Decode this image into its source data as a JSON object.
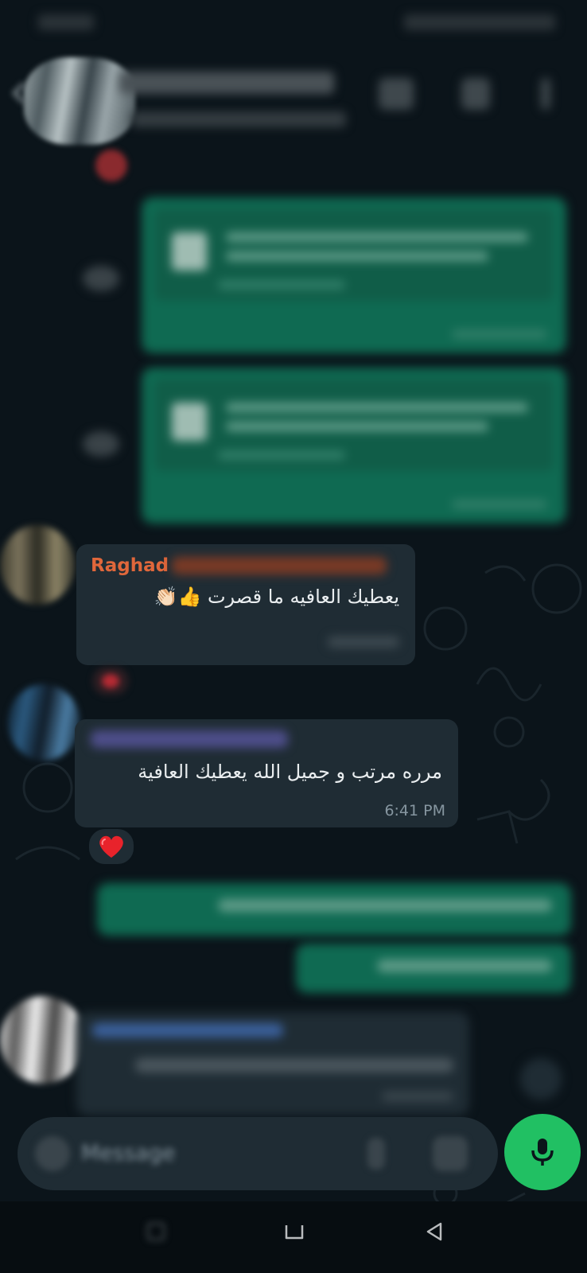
{
  "status_bar": {},
  "header": {},
  "messages": {
    "incoming_1": {
      "sender": "Raghad",
      "text": "يعطيك العافيه ما قصرت 👍👏🏻",
      "reaction": "❤"
    },
    "incoming_2": {
      "text": "مرره مرتب و جميل الله يعطيك العافية",
      "time": "6:41 PM",
      "reaction": "❤️"
    }
  },
  "input": {
    "placeholder": "Message"
  },
  "colors": {
    "background": "#0b141a",
    "incoming_bubble": "#1f2c34",
    "outgoing_bubble": "#0f6a52",
    "accent_green": "#21c063",
    "sender_raghad": "#e0673b",
    "time_gray": "#8696a0"
  },
  "icons": [
    "back-arrow-icon",
    "video-call-icon",
    "phone-icon",
    "more-icon",
    "document-icon",
    "forward-icon",
    "emoji-icon",
    "attach-icon",
    "camera-icon",
    "mic-icon",
    "nav-recents-icon",
    "nav-home-icon",
    "nav-back-icon"
  ]
}
